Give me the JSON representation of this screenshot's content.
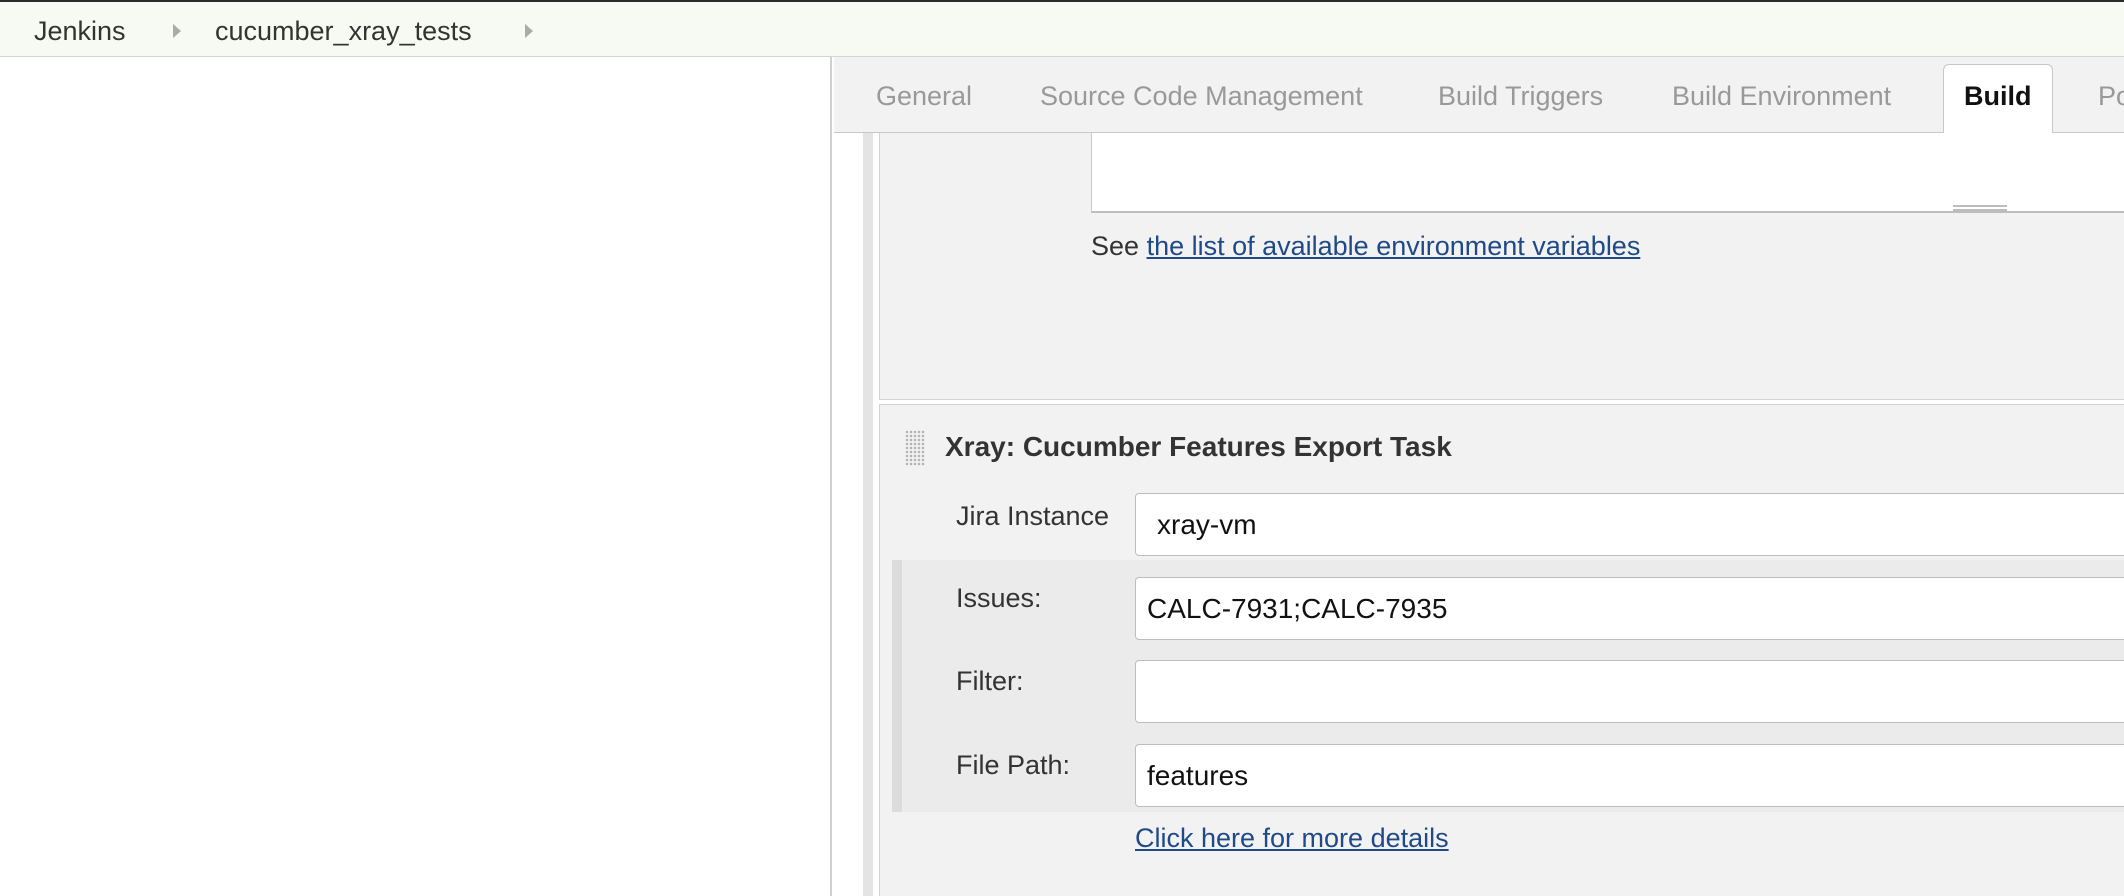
{
  "breadcrumb": {
    "items": [
      {
        "label": "Jenkins"
      },
      {
        "label": "cucumber_xray_tests"
      }
    ]
  },
  "tabs": [
    {
      "label": "General",
      "active": false
    },
    {
      "label": "Source Code Management",
      "active": false
    },
    {
      "label": "Build Triggers",
      "active": false
    },
    {
      "label": "Build Environment",
      "active": false
    },
    {
      "label": "Build",
      "active": true
    },
    {
      "label": "Po",
      "active": false
    }
  ],
  "shell_step": {
    "command_value": "",
    "see_prefix": "See",
    "env_vars_link": "the list of available environment variables"
  },
  "xray_step": {
    "title": "Xray: Cucumber Features Export Task",
    "jira_instance": {
      "label": "Jira Instance",
      "selected": "xray-vm"
    },
    "issues": {
      "label": "Issues:",
      "value": "CALC-7931;CALC-7935"
    },
    "filter": {
      "label": "Filter:",
      "value": ""
    },
    "file_path": {
      "label": "File Path:",
      "value": "features"
    },
    "details_link": "Click here for more details"
  },
  "colors": {
    "link": "#204a87",
    "breadcrumb_bg": "#f6faf2",
    "section_bg": "#f2f2f2",
    "active_tab_text": "#111111",
    "inactive_tab_text": "#999999"
  }
}
